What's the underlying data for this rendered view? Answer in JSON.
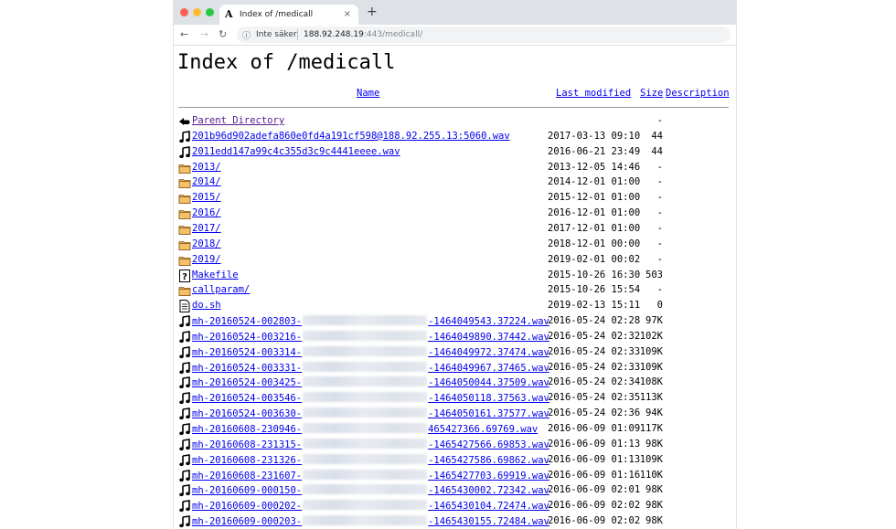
{
  "browser": {
    "tab_title": "Index of /medicall",
    "tab_close": "×",
    "new_tab": "+",
    "security_label": "Inte säker",
    "url_host": "188.92.248.19",
    "url_rest": ":443/medicall/"
  },
  "page": {
    "title": "Index of /medicall",
    "columns": {
      "name": "Name",
      "last_modified": "Last modified",
      "size": "Size",
      "description": "Description"
    }
  },
  "rows": [
    {
      "icon": "back",
      "name": "Parent Directory",
      "suffix": "",
      "date": "",
      "size": "-"
    },
    {
      "icon": "sound",
      "name": "201b96d902adefa860e0fd4a191cf598@188.92.255.13:5060.wav",
      "suffix": "",
      "date": "2017-03-13 09:10",
      "size": "44"
    },
    {
      "icon": "sound",
      "name": "2011edd147a99c4c355d3c9c4441eeee.wav",
      "suffix": "",
      "date": "2016-06-21 23:49",
      "size": "44"
    },
    {
      "icon": "folder",
      "name": "2013/",
      "suffix": "",
      "date": "2013-12-05 14:46",
      "size": "-"
    },
    {
      "icon": "folder",
      "name": "2014/",
      "suffix": "",
      "date": "2014-12-01 01:00",
      "size": "-"
    },
    {
      "icon": "folder",
      "name": "2015/",
      "suffix": "",
      "date": "2015-12-01 01:00",
      "size": "-"
    },
    {
      "icon": "folder",
      "name": "2016/",
      "suffix": "",
      "date": "2016-12-01 01:00",
      "size": "-"
    },
    {
      "icon": "folder",
      "name": "2017/",
      "suffix": "",
      "date": "2017-12-01 01:00",
      "size": "-"
    },
    {
      "icon": "folder",
      "name": "2018/",
      "suffix": "",
      "date": "2018-12-01 00:00",
      "size": "-"
    },
    {
      "icon": "folder",
      "name": "2019/",
      "suffix": "",
      "date": "2019-02-01 00:02",
      "size": "-"
    },
    {
      "icon": "unknown",
      "name": "Makefile",
      "suffix": "",
      "date": "2015-10-26 16:30",
      "size": "503"
    },
    {
      "icon": "folder",
      "name": "callparam/",
      "suffix": "",
      "date": "2015-10-26 15:54",
      "size": "-"
    },
    {
      "icon": "text",
      "name": "do.sh",
      "suffix": "",
      "date": "2019-02-13 15:11",
      "size": "0"
    },
    {
      "icon": "sound",
      "name": "mh-20160524-002803-",
      "suffix": "-1464049543.37224.wav",
      "date": "2016-05-24 02:28",
      "size": "97K"
    },
    {
      "icon": "sound",
      "name": "mh-20160524-003216-",
      "suffix": "-1464049890.37442.wav",
      "date": "2016-05-24 02:32",
      "size": "102K"
    },
    {
      "icon": "sound",
      "name": "mh-20160524-003314-",
      "suffix": "-1464049972.37474.wav",
      "date": "2016-05-24 02:33",
      "size": "109K"
    },
    {
      "icon": "sound",
      "name": "mh-20160524-003331-",
      "suffix": "-1464049967.37465.wav",
      "date": "2016-05-24 02:33",
      "size": "109K"
    },
    {
      "icon": "sound",
      "name": "mh-20160524-003425-",
      "suffix": "-1464050044.37509.wav",
      "date": "2016-05-24 02:34",
      "size": "108K"
    },
    {
      "icon": "sound",
      "name": "mh-20160524-003546-",
      "suffix": "-1464050118.37563.wav",
      "date": "2016-05-24 02:35",
      "size": "113K"
    },
    {
      "icon": "sound",
      "name": "mh-20160524-003630-",
      "suffix": "-1464050161.37577.wav",
      "date": "2016-05-24 02:36",
      "size": "94K"
    },
    {
      "icon": "sound",
      "name": "mh-20160608-230946-",
      "suffix": "465427366.69769.wav",
      "date": "2016-06-09 01:09",
      "size": "117K"
    },
    {
      "icon": "sound",
      "name": "mh-20160608-231315-",
      "suffix": "-1465427566.69853.wav",
      "date": "2016-06-09 01:13",
      "size": "98K"
    },
    {
      "icon": "sound",
      "name": "mh-20160608-231326-",
      "suffix": "-1465427586.69862.wav",
      "date": "2016-06-09 01:13",
      "size": "109K"
    },
    {
      "icon": "sound",
      "name": "mh-20160608-231607-",
      "suffix": "-1465427703.69919.wav",
      "date": "2016-06-09 01:16",
      "size": "110K"
    },
    {
      "icon": "sound",
      "name": "mh-20160609-000150-",
      "suffix": "-1465430002.72342.wav",
      "date": "2016-06-09 02:01",
      "size": "98K"
    },
    {
      "icon": "sound",
      "name": "mh-20160609-000202-",
      "suffix": "-1465430104.72474.wav",
      "date": "2016-06-09 02:02",
      "size": "98K"
    },
    {
      "icon": "sound",
      "name": "mh-20160609-000203-",
      "suffix": "-1465430155.72484.wav",
      "date": "2016-06-09 02:02",
      "size": "98K"
    }
  ]
}
